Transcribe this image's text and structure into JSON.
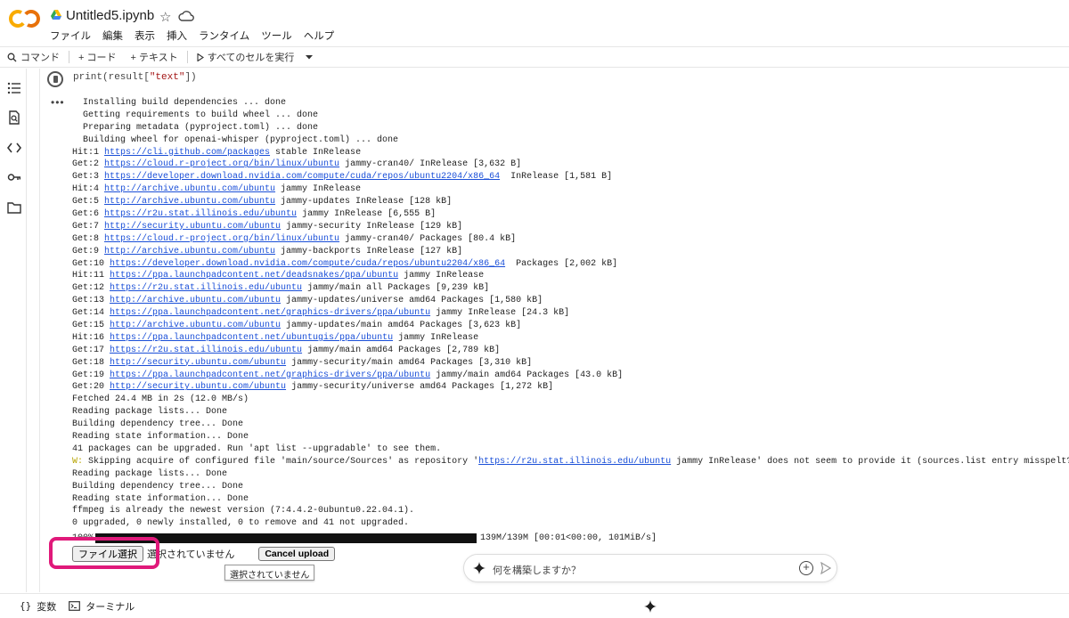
{
  "header": {
    "app_logo": "CO",
    "title": "Untitled5.ipynb",
    "menu": [
      "ファイル",
      "編集",
      "表示",
      "挿入",
      "ランタイム",
      "ツール",
      "ヘルプ"
    ]
  },
  "toolbar": {
    "commands_label": "コマンド",
    "code_label": "+ コード",
    "text_label": "+ テキスト",
    "run_all_label": "すべてのセルを実行"
  },
  "cell": {
    "code_prefix": "print(result[",
    "code_string": "\"text\"",
    "code_suffix": "])"
  },
  "output": {
    "dots": "•••",
    "lines": [
      {
        "t": "  Installing build dependencies ... done"
      },
      {
        "t": "  Getting requirements to build wheel ... done"
      },
      {
        "t": "  Preparing metadata (pyproject.toml) ... done"
      },
      {
        "t": "  Building wheel for openai-whisper (pyproject.toml) ... done"
      },
      {
        "p": "Hit:1 ",
        "u": "https://cli.github.com/packages",
        "s": " stable InRelease"
      },
      {
        "p": "Get:2 ",
        "u": "https://cloud.r-project.org/bin/linux/ubuntu",
        "s": " jammy-cran40/ InRelease [3,632 B]"
      },
      {
        "p": "Get:3 ",
        "u": "https://developer.download.nvidia.com/compute/cuda/repos/ubuntu2204/x86_64",
        "s": "  InRelease [1,581 B]"
      },
      {
        "p": "Hit:4 ",
        "u": "http://archive.ubuntu.com/ubuntu",
        "s": " jammy InRelease"
      },
      {
        "p": "Get:5 ",
        "u": "http://archive.ubuntu.com/ubuntu",
        "s": " jammy-updates InRelease [128 kB]"
      },
      {
        "p": "Get:6 ",
        "u": "https://r2u.stat.illinois.edu/ubuntu",
        "s": " jammy InRelease [6,555 B]"
      },
      {
        "p": "Get:7 ",
        "u": "http://security.ubuntu.com/ubuntu",
        "s": " jammy-security InRelease [129 kB]"
      },
      {
        "p": "Get:8 ",
        "u": "https://cloud.r-project.org/bin/linux/ubuntu",
        "s": " jammy-cran40/ Packages [80.4 kB]"
      },
      {
        "p": "Get:9 ",
        "u": "http://archive.ubuntu.com/ubuntu",
        "s": " jammy-backports InRelease [127 kB]"
      },
      {
        "p": "Get:10 ",
        "u": "https://developer.download.nvidia.com/compute/cuda/repos/ubuntu2204/x86_64",
        "s": "  Packages [2,002 kB]"
      },
      {
        "p": "Hit:11 ",
        "u": "https://ppa.launchpadcontent.net/deadsnakes/ppa/ubuntu",
        "s": " jammy InRelease"
      },
      {
        "p": "Get:12 ",
        "u": "https://r2u.stat.illinois.edu/ubuntu",
        "s": " jammy/main all Packages [9,239 kB]"
      },
      {
        "p": "Get:13 ",
        "u": "http://archive.ubuntu.com/ubuntu",
        "s": " jammy-updates/universe amd64 Packages [1,580 kB]"
      },
      {
        "p": "Get:14 ",
        "u": "https://ppa.launchpadcontent.net/graphics-drivers/ppa/ubuntu",
        "s": " jammy InRelease [24.3 kB]"
      },
      {
        "p": "Get:15 ",
        "u": "http://archive.ubuntu.com/ubuntu",
        "s": " jammy-updates/main amd64 Packages [3,623 kB]"
      },
      {
        "p": "Hit:16 ",
        "u": "https://ppa.launchpadcontent.net/ubuntugis/ppa/ubuntu",
        "s": " jammy InRelease"
      },
      {
        "p": "Get:17 ",
        "u": "https://r2u.stat.illinois.edu/ubuntu",
        "s": " jammy/main amd64 Packages [2,789 kB]"
      },
      {
        "p": "Get:18 ",
        "u": "http://security.ubuntu.com/ubuntu",
        "s": " jammy-security/main amd64 Packages [3,310 kB]"
      },
      {
        "p": "Get:19 ",
        "u": "https://ppa.launchpadcontent.net/graphics-drivers/ppa/ubuntu",
        "s": " jammy/main amd64 Packages [43.0 kB]"
      },
      {
        "p": "Get:20 ",
        "u": "http://security.ubuntu.com/ubuntu",
        "s": " jammy-security/universe amd64 Packages [1,272 kB]"
      },
      {
        "t": "Fetched 24.4 MB in 2s (12.0 MB/s)"
      },
      {
        "t": "Reading package lists... Done"
      },
      {
        "t": "Building dependency tree... Done"
      },
      {
        "t": "Reading state information... Done"
      },
      {
        "t": "41 packages can be upgraded. Run 'apt list --upgradable' to see them."
      },
      {
        "w": "W: ",
        "p": "Skipping acquire of configured file 'main/source/Sources' as repository '",
        "u": "https://r2u.stat.illinois.edu/ubuntu",
        "s": " jammy InRelease' does not seem to provide it (sources.list entry misspelt?)"
      },
      {
        "t": "Reading package lists... Done"
      },
      {
        "t": "Building dependency tree... Done"
      },
      {
        "t": "Reading state information... Done"
      },
      {
        "t": "ffmpeg is already the newest version (7:4.4.2-0ubuntu0.22.04.1)."
      },
      {
        "t": "0 upgraded, 0 newly installed, 0 to remove and 41 not upgraded."
      }
    ],
    "progress": {
      "label": "100%",
      "fraction": 1.0,
      "text": "139M/139M [00:01<00:00, 101MiB/s]"
    }
  },
  "upload": {
    "choose_file_label": "ファイル選択",
    "file_status": "選択されていません",
    "cancel_label": "Cancel upload",
    "tooltip": "選択されていません"
  },
  "prompt": {
    "placeholder": "何を構築しますか？"
  },
  "bottom": {
    "variables_label": "変数",
    "terminal_label": "ターミナル"
  }
}
